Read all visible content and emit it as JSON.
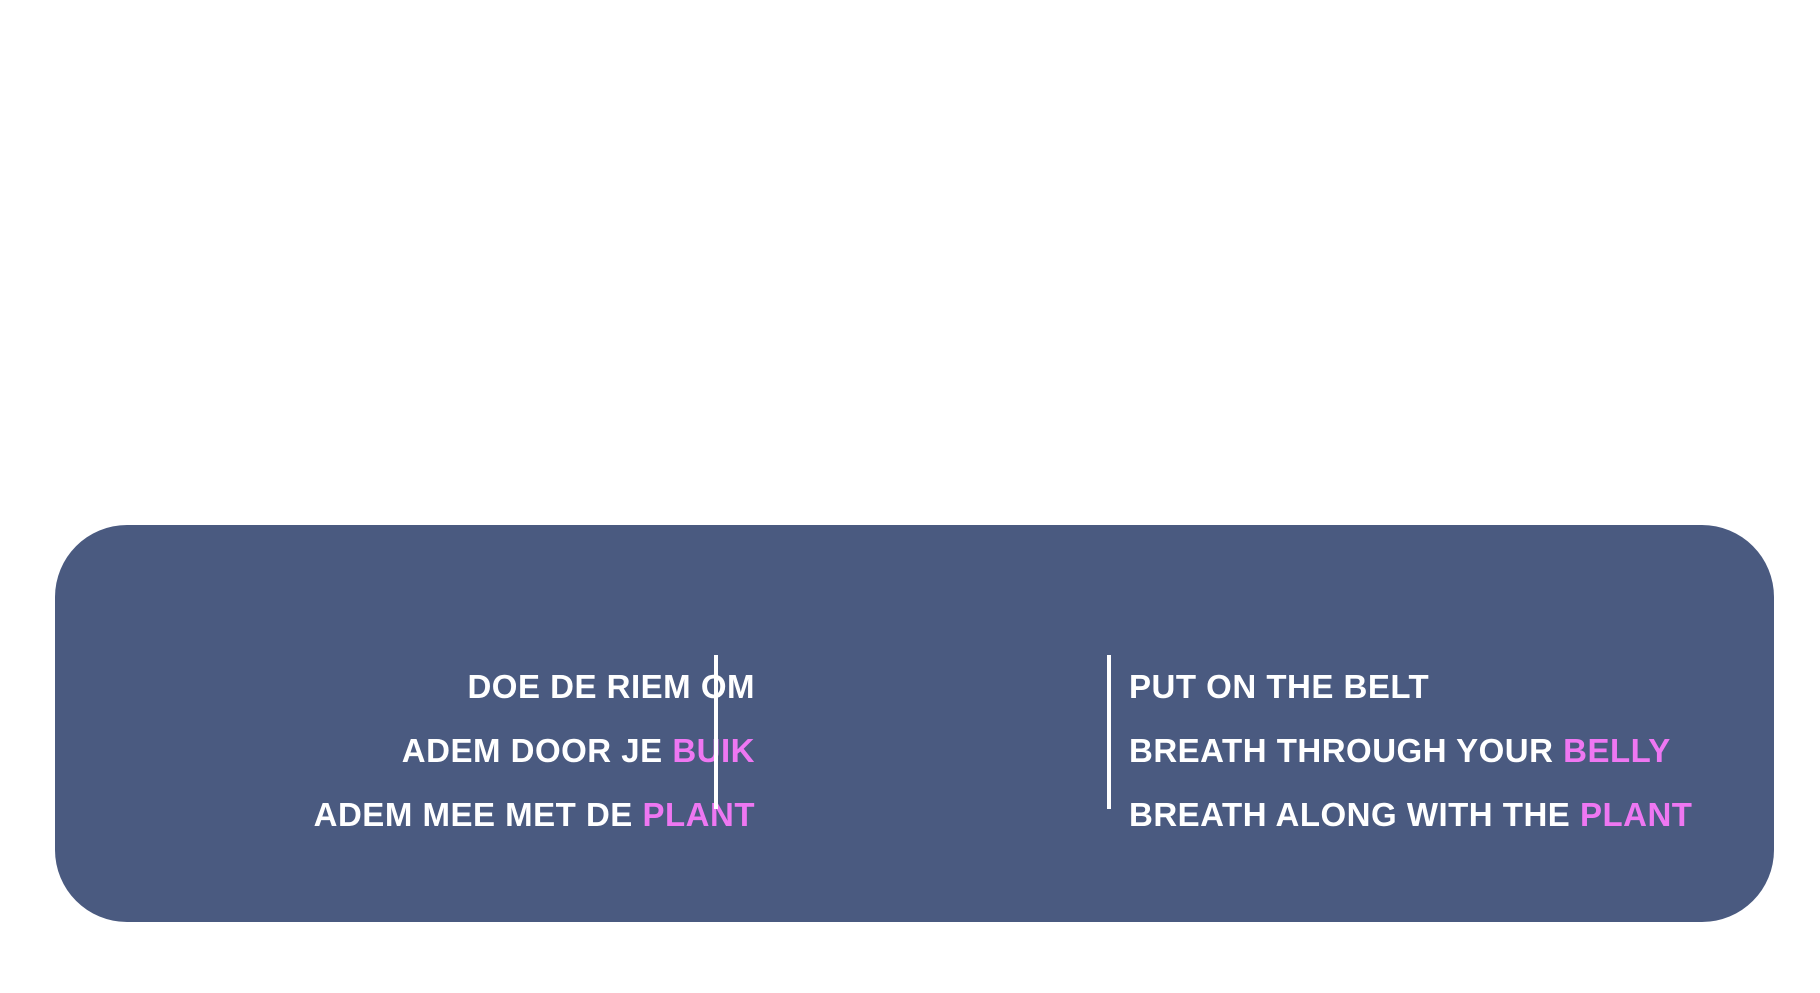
{
  "colors": {
    "background": "#ffffff",
    "panel": "#4a5a80",
    "text": "#ffffff",
    "accent": "#ee77f2"
  },
  "instructions": {
    "dutch": [
      {
        "text": "DOE DE RIEM OM",
        "highlight": ""
      },
      {
        "text": "ADEM DOOR JE ",
        "highlight": "BUIK"
      },
      {
        "text": "ADEM MEE MET DE ",
        "highlight": "PLANT"
      }
    ],
    "english": [
      {
        "text": "PUT ON THE BELT",
        "highlight": ""
      },
      {
        "text": "BREATH THROUGH YOUR ",
        "highlight": "BELLY"
      },
      {
        "text": "BREATH ALONG WITH THE ",
        "highlight": "PLANT"
      }
    ]
  }
}
